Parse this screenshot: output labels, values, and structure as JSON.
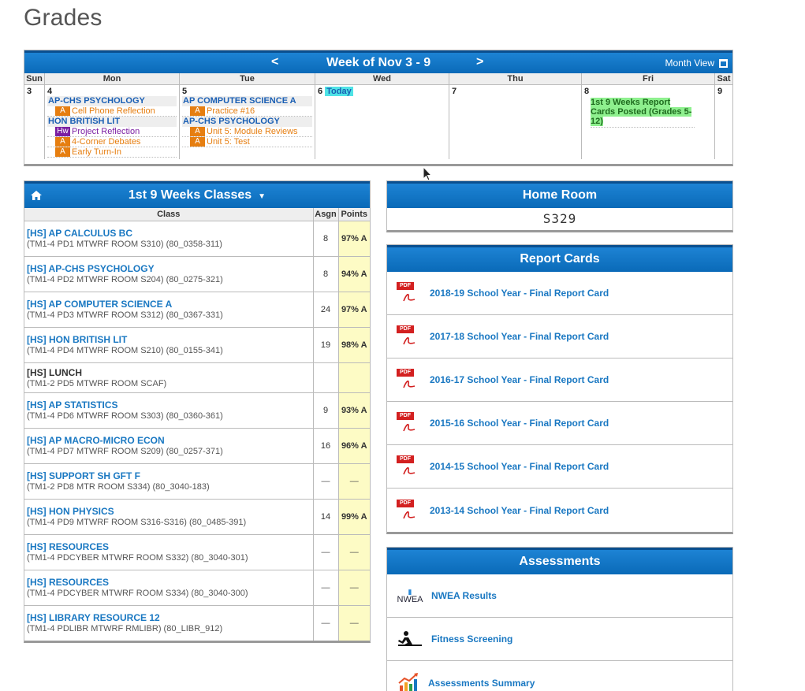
{
  "page": {
    "title": "Grades"
  },
  "calendar": {
    "title": "Week of Nov 3 - 9",
    "prev": "<",
    "next": ">",
    "month_view": "Month View",
    "days": [
      {
        "name": "Sun",
        "num": "3"
      },
      {
        "name": "Mon",
        "num": "4"
      },
      {
        "name": "Tue",
        "num": "5"
      },
      {
        "name": "Wed",
        "num": "6",
        "today": "Today"
      },
      {
        "name": "Thu",
        "num": "7"
      },
      {
        "name": "Fri",
        "num": "8",
        "event": "1st 9 Weeks Report Cards Posted (Grades 5-12)"
      },
      {
        "name": "Sat",
        "num": "9"
      }
    ],
    "mon": {
      "class1": "AP-CHS PSYCHOLOGY",
      "item1": {
        "badge": "A",
        "text": "Cell Phone Reflection"
      },
      "class2": "HON BRITISH LIT",
      "item2": {
        "badge": "Hw",
        "text": "Project Reflection"
      },
      "item3": {
        "badge": "A",
        "text": "4-Corner Debates"
      },
      "item4": {
        "badge": "A",
        "text": "Early Turn-In"
      }
    },
    "tue": {
      "class1": "AP COMPUTER SCIENCE A",
      "item1": {
        "badge": "A",
        "text": "Practice #16"
      },
      "class2": "AP-CHS PSYCHOLOGY",
      "item2": {
        "badge": "A",
        "text": "Unit 5: Module Reviews"
      },
      "item3": {
        "badge": "A",
        "text": "Unit 5: Test"
      }
    },
    "colors": {
      "header": "#0a6ab8",
      "assignment": "#e67e10",
      "homework": "#7b1fa2",
      "today": "#4fe3e6",
      "event": "#8ef08e"
    }
  },
  "classes": {
    "title": "1st 9 Weeks Classes",
    "columns": [
      "Class",
      "Asgn",
      "Points"
    ],
    "rows": [
      {
        "name": "[HS] AP CALCULUS BC",
        "detail": "(TM1-4 PD1 MTWRF ROOM S310) (80_0358-311)",
        "asgn": "8",
        "points": "97% A"
      },
      {
        "name": "[HS] AP-CHS PSYCHOLOGY",
        "detail": "(TM1-4 PD2 MTWRF ROOM S204) (80_0275-321)",
        "asgn": "8",
        "points": "94% A"
      },
      {
        "name": "[HS] AP COMPUTER SCIENCE A",
        "detail": "(TM1-4 PD3 MTWRF ROOM S312) (80_0367-331)",
        "asgn": "24",
        "points": "97% A"
      },
      {
        "name": "[HS] HON BRITISH LIT",
        "detail": "(TM1-4 PD4 MTWRF ROOM S210) (80_0155-341)",
        "asgn": "19",
        "points": "98% A"
      },
      {
        "name": "[HS] LUNCH",
        "detail": "(TM1-2 PD5 MTWRF ROOM SCAF)",
        "asgn": "",
        "points": ""
      },
      {
        "name": "[HS] AP STATISTICS",
        "detail": "(TM1-4 PD6 MTWRF ROOM S303) (80_0360-361)",
        "asgn": "9",
        "points": "93% A"
      },
      {
        "name": "[HS] AP MACRO-MICRO ECON",
        "detail": "(TM1-4 PD7 MTWRF ROOM S209) (80_0257-371)",
        "asgn": "16",
        "points": "96% A"
      },
      {
        "name": "[HS] SUPPORT SH GFT F",
        "detail": "(TM1-2 PD8 MTR ROOM S334) (80_3040-183)",
        "asgn": "—",
        "points": "—"
      },
      {
        "name": "[HS] HON PHYSICS",
        "detail": "(TM1-4 PD9 MTWRF ROOM S316-S316) (80_0485-391)",
        "asgn": "14",
        "points": "99% A"
      },
      {
        "name": "[HS] RESOURCES",
        "detail": "(TM1-4 PDCYBER MTWRF ROOM S332) (80_3040-301)",
        "asgn": "—",
        "points": "—"
      },
      {
        "name": "[HS] RESOURCES",
        "detail": "(TM1-4 PDCYBER MTWRF ROOM S334) (80_3040-300)",
        "asgn": "—",
        "points": "—"
      },
      {
        "name": "[HS] LIBRARY RESOURCE 12",
        "detail": "(TM1-4 PDLIBR MTWRF RMLIBR) (80_LIBR_912)",
        "asgn": "—",
        "points": "—"
      }
    ]
  },
  "homeroom": {
    "title": "Home Room",
    "value": "S329"
  },
  "report_cards": {
    "title": "Report Cards",
    "items": [
      "2018-19 School Year - Final Report Card",
      "2017-18 School Year - Final Report Card",
      "2016-17 School Year - Final Report Card",
      "2015-16 School Year - Final Report Card",
      "2014-15 School Year - Final Report Card",
      "2013-14 School Year - Final Report Card"
    ],
    "pdf_label": "PDF"
  },
  "assessments": {
    "title": "Assessments",
    "items": [
      {
        "label": "NWEA Results",
        "icon": "nwea-logo-icon",
        "icon_text": "NWEA"
      },
      {
        "label": "Fitness Screening",
        "icon": "fitness-icon"
      },
      {
        "label": "Assessments Summary",
        "icon": "bar-chart-icon"
      }
    ]
  }
}
